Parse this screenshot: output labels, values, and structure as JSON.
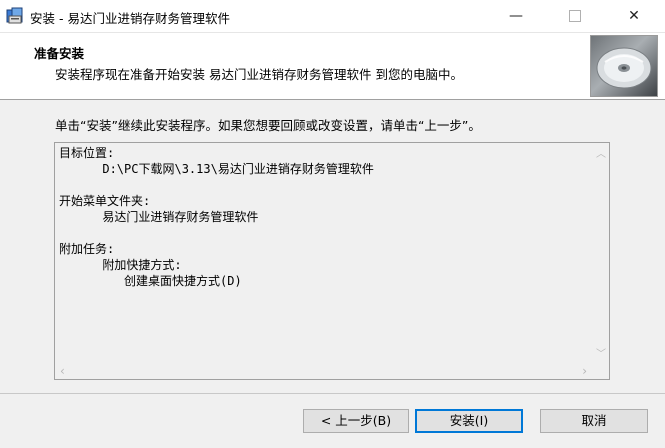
{
  "window": {
    "title": "安装 - 易达门业进销存财务管理软件",
    "minimize_glyph": "—",
    "close_glyph": "✕"
  },
  "header": {
    "title": "准备安装",
    "subtitle": "安装程序现在准备开始安装 易达门业进销存财务管理软件 到您的电脑中。"
  },
  "intro": "单击“安装”继续此安装程序。如果您想要回顾或改变设置，请单击“上一步”。",
  "memo": {
    "lines": [
      "目标位置:",
      "      D:\\PC下载网\\3.13\\易达门业进销存财务管理软件",
      "",
      "开始菜单文件夹:",
      "      易达门业进销存财务管理软件",
      "",
      "附加任务:",
      "      附加快捷方式:",
      "         创建桌面快捷方式(D)"
    ]
  },
  "buttons": {
    "back": "< 上一步(B)",
    "install": "安装(I)",
    "cancel": "取消"
  },
  "icons": [
    "installer-app-icon",
    "cd-disc-icon",
    "scroll-up-icon",
    "scroll-down-icon",
    "scroll-left-icon",
    "scroll-right-icon"
  ]
}
